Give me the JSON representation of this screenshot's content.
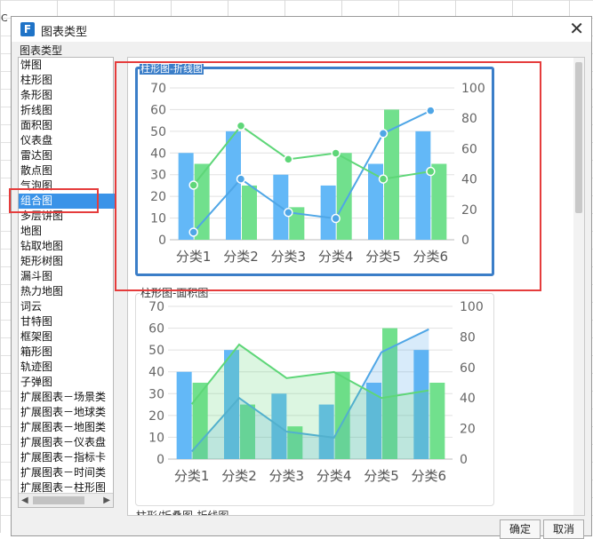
{
  "dialog": {
    "title": "图表类型",
    "section_label": "图表类型",
    "app_icon_letter": "F"
  },
  "type_list": {
    "items": [
      "饼图",
      "柱形图",
      "条形图",
      "折线图",
      "面积图",
      "仪表盘",
      "雷达图",
      "散点图",
      "气泡图",
      "组合图",
      "多层饼图",
      "地图",
      "钻取地图",
      "矩形树图",
      "漏斗图",
      "热力地图",
      "词云",
      "甘特图",
      "框架图",
      "箱形图",
      "轨迹图",
      "子弹图",
      "扩展图表－场景类",
      "扩展图表－地球类",
      "扩展图表－地图类",
      "扩展图表－仪表盘",
      "扩展图表－指标卡",
      "扩展图表－时间类",
      "扩展图表－柱形图"
    ],
    "selected_index": 9
  },
  "preview": {
    "cards": [
      {
        "title": "柱形图-折线图"
      },
      {
        "title": "柱形图-面积图"
      }
    ],
    "third_title": "柱形/折叠图-折线图"
  },
  "buttons": {
    "ok": "确定",
    "cancel": "取消"
  },
  "colors": {
    "bar_blue": "#63b8f7",
    "bar_green": "#71e08d",
    "line_blue": "#4fa6e6",
    "line_green": "#5ed678",
    "area_fill": "#c9e9f6",
    "selection_border": "#3b7ec8",
    "highlight_red": "#e53c3c"
  },
  "chart_data": [
    {
      "type": "bar",
      "title": "柱形图-折线图",
      "categories": [
        "分类1",
        "分类2",
        "分类3",
        "分类4",
        "分类5",
        "分类6"
      ],
      "series": [
        {
          "type": "bar",
          "axis": "left",
          "values": [
            40,
            50,
            30,
            25,
            35,
            50
          ]
        },
        {
          "type": "bar",
          "axis": "left",
          "values": [
            35,
            25,
            15,
            40,
            60,
            35
          ]
        },
        {
          "type": "line",
          "axis": "right",
          "values": [
            5,
            40,
            18,
            14,
            70,
            85
          ]
        },
        {
          "type": "line",
          "axis": "right",
          "values": [
            36,
            75,
            53,
            57,
            40,
            45
          ]
        }
      ],
      "ylim_left": [
        0,
        70
      ],
      "ylim_right": [
        0,
        100
      ],
      "yticks_left": [
        0,
        10,
        20,
        30,
        40,
        50,
        60,
        70
      ],
      "yticks_right": [
        0,
        20,
        40,
        60,
        80,
        100
      ],
      "grid": true
    },
    {
      "type": "bar",
      "title": "柱形图-面积图",
      "categories": [
        "分类1",
        "分类2",
        "分类3",
        "分类4",
        "分类5",
        "分类6"
      ],
      "series": [
        {
          "type": "bar",
          "axis": "left",
          "values": [
            40,
            50,
            30,
            25,
            35,
            50
          ]
        },
        {
          "type": "bar",
          "axis": "left",
          "values": [
            35,
            25,
            15,
            40,
            60,
            35
          ]
        },
        {
          "type": "area",
          "axis": "right",
          "values": [
            5,
            40,
            18,
            14,
            70,
            85
          ]
        },
        {
          "type": "area",
          "axis": "right",
          "values": [
            36,
            75,
            53,
            57,
            40,
            45
          ]
        }
      ],
      "ylim_left": [
        0,
        70
      ],
      "ylim_right": [
        0,
        100
      ],
      "yticks_left": [
        0,
        10,
        20,
        30,
        40,
        50,
        60,
        70
      ],
      "yticks_right": [
        0,
        20,
        40,
        60,
        80,
        100
      ],
      "grid": true
    }
  ]
}
